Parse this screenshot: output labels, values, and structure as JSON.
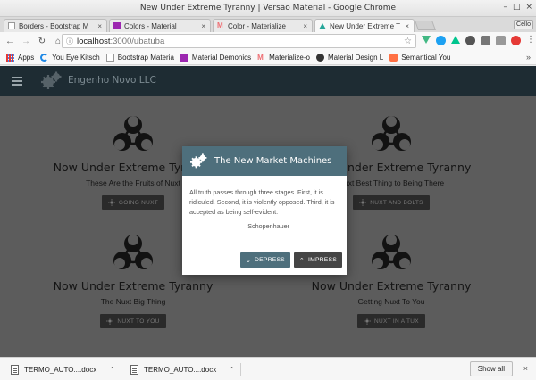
{
  "window": {
    "title": "New Under Extreme Tyranny | Versão Material - Google Chrome"
  },
  "tabs": [
    {
      "label": "Borders - Bootstrap M",
      "close": "×",
      "icon_color": "#bbbbbb",
      "active": false
    },
    {
      "label": "Colors - Material",
      "close": "×",
      "icon_color": "#9c27b0",
      "active": false
    },
    {
      "label": "Color - Materialize",
      "close": "×",
      "icon_color": "#ee6e73",
      "active": false
    },
    {
      "label": "New Under Extreme T",
      "close": "×",
      "icon_color": "#26a69a",
      "active": true
    }
  ],
  "profile": "Cello",
  "toolbar": {
    "url_host": "localhost",
    "url_path": ":3000/ubatuba"
  },
  "bookmarks": {
    "items": [
      {
        "label": "Apps",
        "icon_color": "#e53935"
      },
      {
        "label": "You Eye Kitsch",
        "icon_color": "#1e88e5"
      },
      {
        "label": "Bootstrap Materia",
        "icon_color": "#cccccc"
      },
      {
        "label": "Material Demonics",
        "icon_color": "#9c27b0"
      },
      {
        "label": "Materialize-o",
        "icon_color": "#ee6e73"
      },
      {
        "label": "Material Design L",
        "icon_color": "#333333"
      },
      {
        "label": "Semantical You",
        "icon_color": "#ff7043"
      }
    ],
    "more": "»"
  },
  "page": {
    "brand": "Engenho Novo LLC",
    "cards": [
      {
        "title": "Now Under Extreme Tyranny",
        "subtitle": "These Are the Fruits of Nuxt",
        "button": "GOING NUXT"
      },
      {
        "title": "Now Under Extreme Tyranny",
        "subtitle": "Nuxt Best Thing to Being There",
        "button": "NUXT AND BOLTS"
      },
      {
        "title": "Now Under Extreme Tyranny",
        "subtitle": "The Nuxt Big Thing",
        "button": "NUXT TO YOU"
      },
      {
        "title": "Now Under Extreme Tyranny",
        "subtitle": "Getting Nuxt To You",
        "button": "NUXT IN A TUX"
      }
    ]
  },
  "modal": {
    "title": "The New Market Machines",
    "quote": "All truth passes through three stages. First, it is ridiculed. Second, it is violently opposed. Third, it is accepted as being self-evident.",
    "author": "— Schopenhauer",
    "depress_label": "DEPRESS",
    "impress_label": "IMPRESS"
  },
  "downloads": {
    "items": [
      {
        "name": "TERMO_AUTO....docx"
      },
      {
        "name": "TERMO_AUTO....docx"
      }
    ],
    "show_all": "Show all"
  },
  "colors": {
    "appbar": "#1e2c33",
    "modal_header": "#4e6f7c",
    "page_overlay": "#5c5c5c"
  }
}
